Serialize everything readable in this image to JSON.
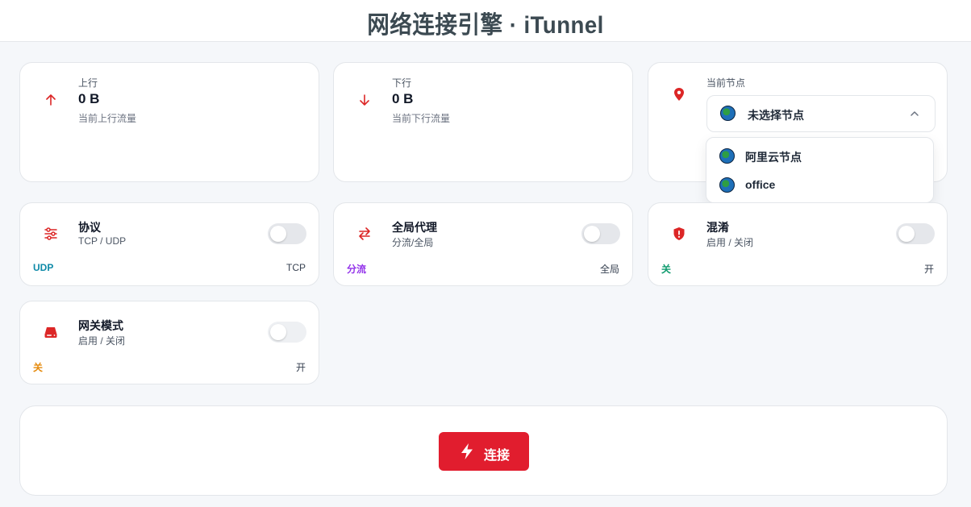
{
  "header": {
    "title": "网络连接引擎 · iTunnel"
  },
  "upload": {
    "label": "上行",
    "value": "0 B",
    "sub": "当前上行流量",
    "icon": "arrow-up-icon"
  },
  "download": {
    "label": "下行",
    "value": "0 B",
    "sub": "当前下行流量",
    "icon": "arrow-down-icon"
  },
  "node": {
    "label": "当前节点",
    "selected": "未选择节点",
    "icon": "location-pin-icon",
    "options": [
      "阿里云节点",
      "office"
    ]
  },
  "toggles": {
    "protocol": {
      "title": "协议",
      "sub": "TCP / UDP",
      "left": "UDP",
      "right": "TCP",
      "left_color": "#0e8aa8",
      "icon": "sliders-icon",
      "on": false
    },
    "global_proxy": {
      "title": "全局代理",
      "sub": "分流/全局",
      "left": "分流",
      "right": "全局",
      "left_color": "#9333ea",
      "icon": "swap-arrows-icon",
      "on": false
    },
    "obfuscation": {
      "title": "混淆",
      "sub": "启用 / 关闭",
      "left": "关",
      "right": "开",
      "left_color": "#0f9b6e",
      "icon": "shield-alert-icon",
      "on": false
    },
    "gateway": {
      "title": "网关模式",
      "sub": "启用 / 关闭",
      "left": "关",
      "right": "开",
      "left_color": "#e58a0c",
      "icon": "router-icon",
      "on": false
    }
  },
  "connect": {
    "label": "连接",
    "icon": "lightning-icon"
  },
  "colors": {
    "accent": "#e11d2e",
    "icon": "#dc2626"
  }
}
